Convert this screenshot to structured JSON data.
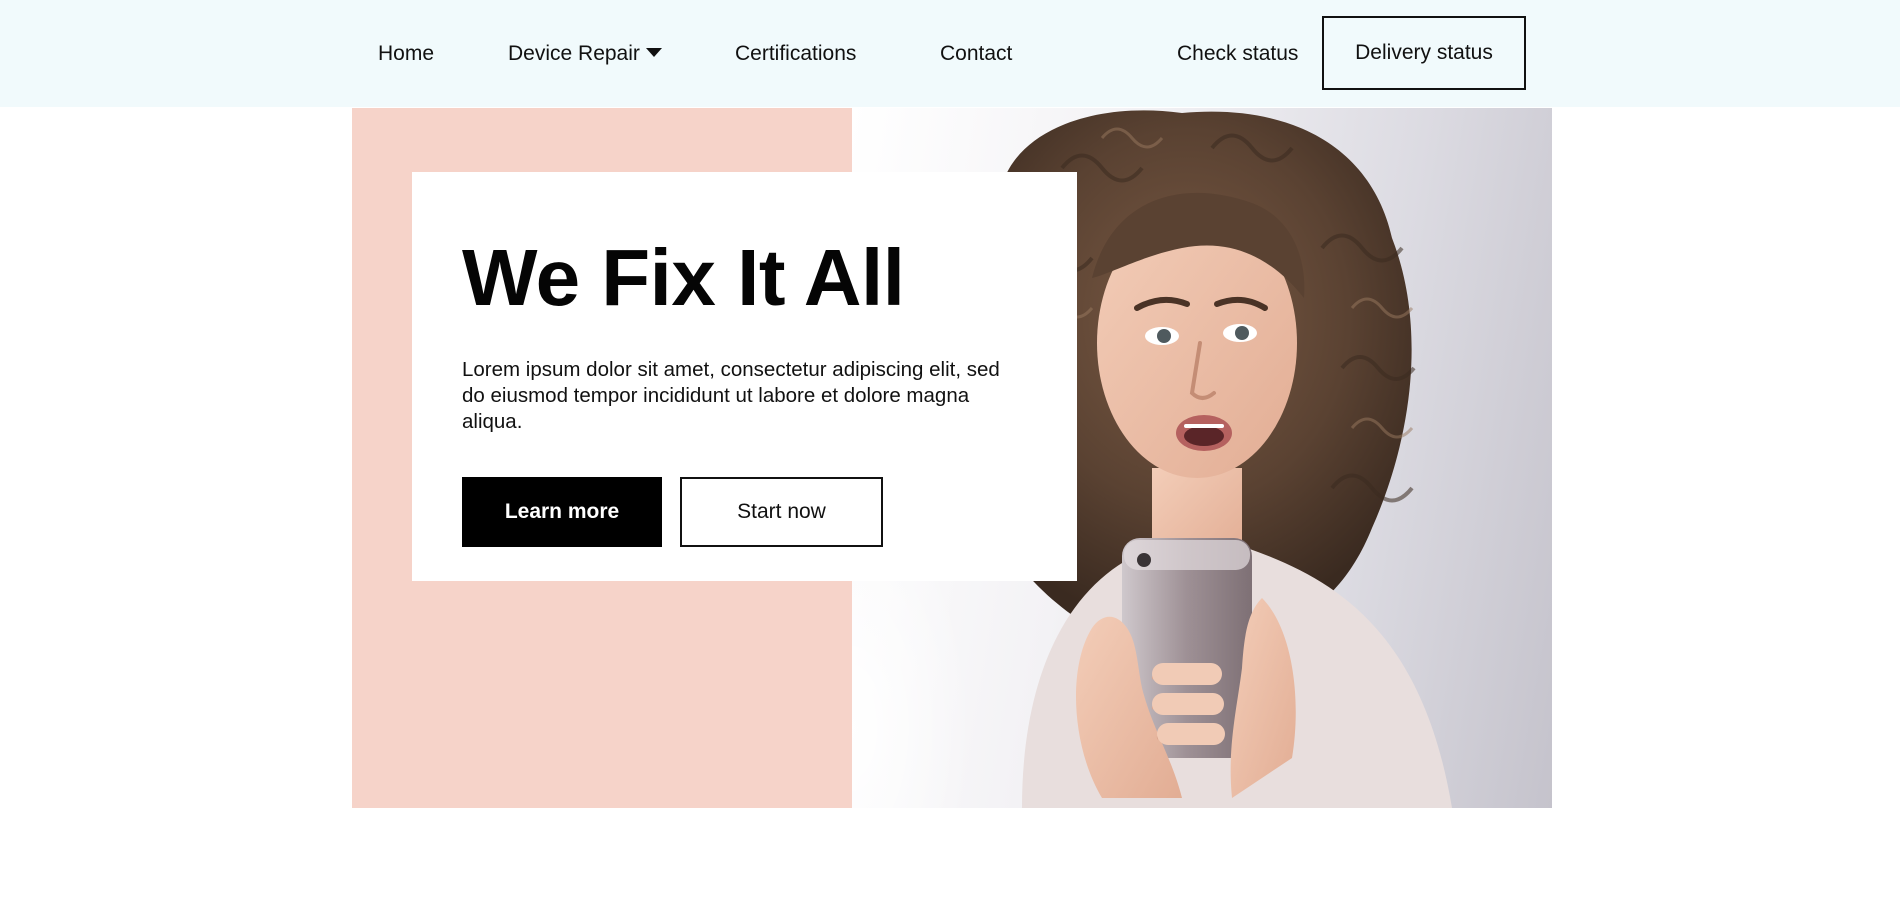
{
  "nav": {
    "home": "Home",
    "device_repair": "Device Repair",
    "certifications": "Certifications",
    "contact": "Contact",
    "check_status": "Check status",
    "delivery_status": "Delivery status"
  },
  "hero": {
    "title": "We Fix It All",
    "body": "Lorem ipsum dolor sit amet, consectetur adipiscing elit, sed do eiusmod tempor incididunt ut labore et dolore magna aliqua.",
    "learn_more": "Learn more",
    "start_now": "Start now",
    "image_alt": "Woman with curly hair looking surprised at her smartphone"
  },
  "colors": {
    "topbar_bg": "#f1fafc",
    "hero_pink": "#f6d3c9",
    "primary_button": "#000000",
    "text": "#111111"
  }
}
